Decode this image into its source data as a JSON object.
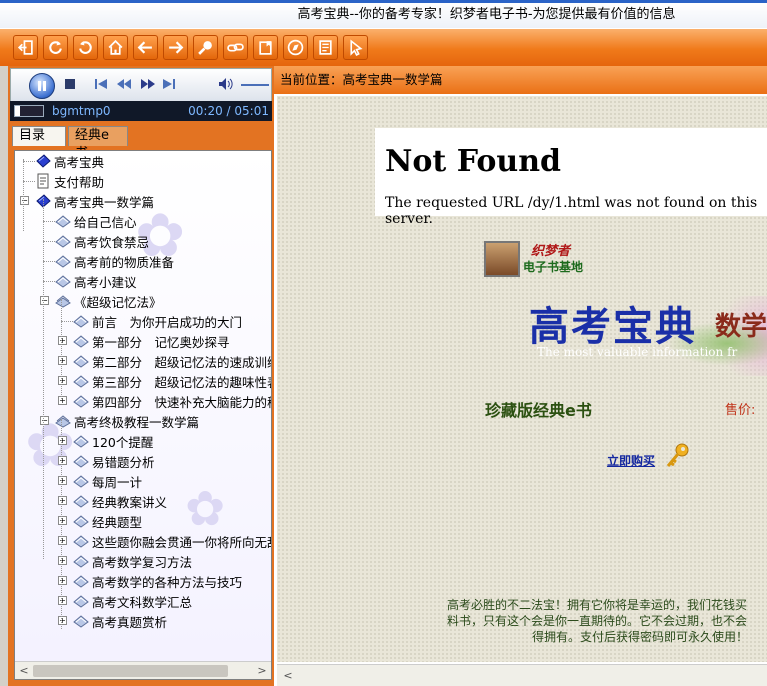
{
  "window": {
    "title": "高考宝典--你的备考专家！织梦者电子书-为您提供最有价值的信息"
  },
  "toolbar": {
    "buttons": [
      {
        "icon": "exit-icon"
      },
      {
        "icon": "refresh-icon"
      },
      {
        "icon": "undo-icon"
      },
      {
        "icon": "home-icon"
      },
      {
        "icon": "back-arrow-icon"
      },
      {
        "icon": "forward-arrow-icon"
      },
      {
        "icon": "search-icon"
      },
      {
        "icon": "link-icon"
      },
      {
        "icon": "bookmark-icon"
      },
      {
        "icon": "compass-icon"
      },
      {
        "icon": "notes-icon"
      },
      {
        "icon": "pointer-icon"
      }
    ]
  },
  "player": {
    "track": "bgmtmp0",
    "time": "00:20 / 05:01"
  },
  "tabs": {
    "contents": "目录",
    "ebook": "经典e书"
  },
  "tree": [
    {
      "label": "高考宝典",
      "level": 0,
      "icon": "book",
      "toggle": ""
    },
    {
      "label": "支付帮助",
      "level": 0,
      "icon": "page",
      "toggle": ""
    },
    {
      "label": "高考宝典一数学篇",
      "level": 0,
      "icon": "book",
      "toggle": "-"
    },
    {
      "label": "给自己信心",
      "level": 1,
      "icon": "closed",
      "toggle": ""
    },
    {
      "label": "高考饮食禁忌",
      "level": 1,
      "icon": "closed",
      "toggle": ""
    },
    {
      "label": "高考前的物质准备",
      "level": 1,
      "icon": "closed",
      "toggle": ""
    },
    {
      "label": "高考小建议",
      "level": 1,
      "icon": "closed",
      "toggle": ""
    },
    {
      "label": "《超级记忆法》",
      "level": 1,
      "icon": "open",
      "toggle": "-"
    },
    {
      "label": "前言　为你开启成功的大门",
      "level": 2,
      "icon": "closed",
      "toggle": ""
    },
    {
      "label": "第一部分　记忆奥妙探寻",
      "level": 2,
      "icon": "closed",
      "toggle": "+"
    },
    {
      "label": "第二部分　超级记忆法的速成训练",
      "level": 2,
      "icon": "closed",
      "toggle": "+"
    },
    {
      "label": "第三部分　超级记忆法的趣味性表现",
      "level": 2,
      "icon": "closed",
      "toggle": "+"
    },
    {
      "label": "第四部分　快速补充大脑能力的秘诀",
      "level": 2,
      "icon": "closed",
      "toggle": "+"
    },
    {
      "label": "高考终极教程一数学篇",
      "level": 1,
      "icon": "open",
      "toggle": "-"
    },
    {
      "label": "120个提醒",
      "level": 2,
      "icon": "closed",
      "toggle": "+"
    },
    {
      "label": "易错题分析",
      "level": 2,
      "icon": "closed",
      "toggle": "+"
    },
    {
      "label": "每周一计",
      "level": 2,
      "icon": "closed",
      "toggle": "+"
    },
    {
      "label": "经典教案讲义",
      "level": 2,
      "icon": "closed",
      "toggle": "+"
    },
    {
      "label": "经典题型",
      "level": 2,
      "icon": "closed",
      "toggle": "+"
    },
    {
      "label": "这些题你融会贯通一你将所向无敌",
      "level": 2,
      "icon": "closed",
      "toggle": "+"
    },
    {
      "label": "高考数学复习方法",
      "level": 2,
      "icon": "closed",
      "toggle": "+"
    },
    {
      "label": "高考数学的各种方法与技巧",
      "level": 2,
      "icon": "closed",
      "toggle": "+"
    },
    {
      "label": "高考文科数学汇总",
      "level": 2,
      "icon": "closed",
      "toggle": "+"
    },
    {
      "label": "高考真题赏析",
      "level": 2,
      "icon": "closed",
      "toggle": "+"
    }
  ],
  "location": {
    "label": "当前位置：",
    "path": "高考宝典一数学篇"
  },
  "page": {
    "error_title": "Not Found",
    "error_message": "The requested URL /dy/1.html was not found on this server.",
    "brand_line1": "织梦者",
    "brand_line2": "电子书基地",
    "banner_title": "高考宝典",
    "banner_sub": "数学",
    "banner_slogan": "The most valuable information fr",
    "edition": "珍藏版经典e书",
    "price_label": "售价:",
    "buy_link": "立即购买",
    "promo_line1": "高考必胜的不二法宝！拥有它你将是幸运的，我们花钱买",
    "promo_line2": "料书，只有这个会是你一直期待的。它不会过期，也不会",
    "promo_line3": "得拥有。支付后获得密码即可永久使用！"
  }
}
